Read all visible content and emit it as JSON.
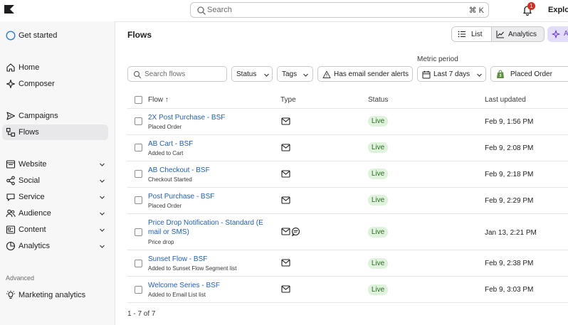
{
  "topbar": {
    "search_placeholder": "Search",
    "search_shortcut": "⌘ K",
    "notification_count": "1",
    "explore_label": "Explor"
  },
  "sidebar": {
    "get_started": "Get started",
    "items": [
      {
        "label": "Home",
        "icon": "home-icon"
      },
      {
        "label": "Composer",
        "icon": "sparkle-icon"
      },
      {
        "label": "Campaigns",
        "icon": "send-icon"
      },
      {
        "label": "Flows",
        "icon": "flows-icon"
      },
      {
        "label": "Website",
        "icon": "website-icon"
      },
      {
        "label": "Social",
        "icon": "share-icon"
      },
      {
        "label": "Service",
        "icon": "chat-icon"
      },
      {
        "label": "Audience",
        "icon": "people-icon"
      },
      {
        "label": "Content",
        "icon": "content-icon"
      },
      {
        "label": "Analytics",
        "icon": "analytics-icon"
      },
      {
        "label": "Marketing analytics",
        "icon": "lightbulb-icon"
      }
    ],
    "section_advanced": "Advanced"
  },
  "main": {
    "title": "Flows",
    "view_list": "List",
    "view_analytics": "Analytics",
    "ai_button": "A",
    "metric_period_label": "Metric period",
    "filters": {
      "search_placeholder": "Search flows",
      "status": "Status",
      "tags": "Tags",
      "email_alerts": "Has email sender alerts",
      "period": "Last 7 days",
      "metric": "Placed Order"
    },
    "columns": {
      "flow": "Flow",
      "sort_indicator": "↑",
      "type": "Type",
      "status": "Status",
      "last_updated": "Last updated"
    },
    "rows": [
      {
        "name": "2X Post Purchase - BSF",
        "trigger": "Placed Order",
        "status": "Live",
        "updated": "Feb 9, 1:56 PM",
        "types": [
          "email"
        ]
      },
      {
        "name": "AB Cart - BSF",
        "trigger": "Added to Cart",
        "status": "Live",
        "updated": "Feb 9, 2:08 PM",
        "types": [
          "email"
        ]
      },
      {
        "name": "AB Checkout - BSF",
        "trigger": "Checkout Started",
        "status": "Live",
        "updated": "Feb 9, 2:18 PM",
        "types": [
          "email"
        ]
      },
      {
        "name": "Post Purchase - BSF",
        "trigger": "Placed Order",
        "status": "Live",
        "updated": "Feb 9, 2:29 PM",
        "types": [
          "email"
        ]
      },
      {
        "name_line1": "Price Drop Notification - Standard (E",
        "name_line2": "mail or SMS)",
        "trigger": "Price drop",
        "status": "Live",
        "updated": "Jan 13, 2:21 PM",
        "types": [
          "email",
          "sms"
        ]
      },
      {
        "name": "Sunset Flow - BSF",
        "trigger": "Added to Sunset Flow Segment list",
        "status": "Live",
        "updated": "Feb 9, 2:38 PM",
        "types": [
          "email"
        ]
      },
      {
        "name": "Welcome Series - BSF",
        "trigger": "Added to Email List list",
        "status": "Live",
        "updated": "Feb 9, 3:03 PM",
        "types": [
          "email"
        ]
      }
    ],
    "pagination": "1 - 7 of 7"
  }
}
